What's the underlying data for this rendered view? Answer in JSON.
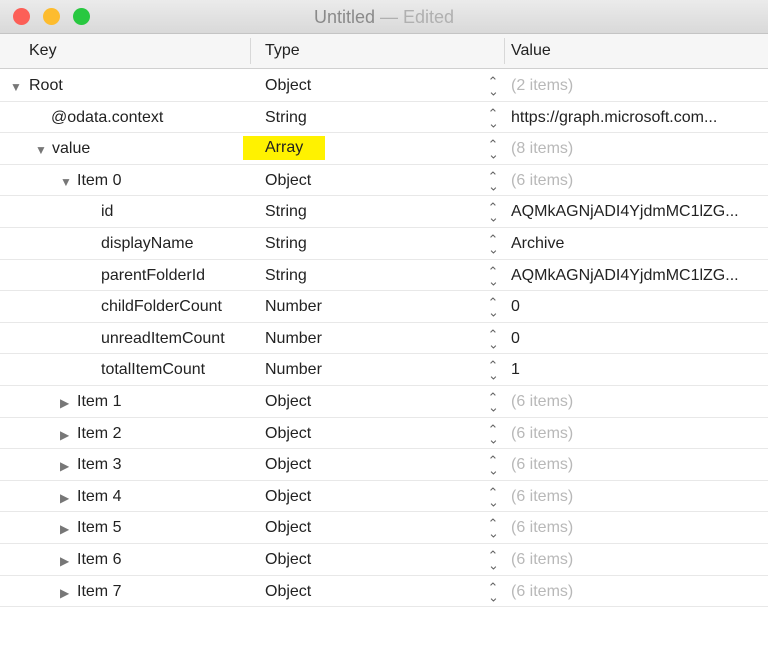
{
  "window": {
    "title": "Untitled",
    "edited": "— Edited"
  },
  "columns": {
    "key": "Key",
    "type": "Type",
    "value": "Value"
  },
  "rows": [
    {
      "key": "Root",
      "type": "Object",
      "value": "(2 items)",
      "level": 0,
      "expander": "expanded",
      "muted": true
    },
    {
      "key": "@odata.context",
      "type": "String",
      "value": "https://graph.microsoft.com...",
      "level": 1,
      "expander": "none"
    },
    {
      "key": "value",
      "type": "Array",
      "value": "(8 items)",
      "level": 1,
      "expander": "expanded",
      "muted": true,
      "highlight": true
    },
    {
      "key": "Item 0",
      "type": "Object",
      "value": "(6 items)",
      "level": 2,
      "expander": "expanded",
      "muted": true
    },
    {
      "key": "id",
      "type": "String",
      "value": "AQMkAGNjADI4YjdmMC1lZG...",
      "level": 3,
      "expander": "none"
    },
    {
      "key": "displayName",
      "type": "String",
      "value": "Archive",
      "level": 3,
      "expander": "none"
    },
    {
      "key": "parentFolderId",
      "type": "String",
      "value": "AQMkAGNjADI4YjdmMC1lZG...",
      "level": 3,
      "expander": "none"
    },
    {
      "key": "childFolderCount",
      "type": "Number",
      "value": "0",
      "level": 3,
      "expander": "none"
    },
    {
      "key": "unreadItemCount",
      "type": "Number",
      "value": "0",
      "level": 3,
      "expander": "none"
    },
    {
      "key": "totalItemCount",
      "type": "Number",
      "value": "1",
      "level": 3,
      "expander": "none"
    },
    {
      "key": "Item 1",
      "type": "Object",
      "value": "(6 items)",
      "level": 2,
      "expander": "collapsed",
      "muted": true
    },
    {
      "key": "Item 2",
      "type": "Object",
      "value": "(6 items)",
      "level": 2,
      "expander": "collapsed",
      "muted": true
    },
    {
      "key": "Item 3",
      "type": "Object",
      "value": "(6 items)",
      "level": 2,
      "expander": "collapsed",
      "muted": true
    },
    {
      "key": "Item 4",
      "type": "Object",
      "value": "(6 items)",
      "level": 2,
      "expander": "collapsed",
      "muted": true
    },
    {
      "key": "Item 5",
      "type": "Object",
      "value": "(6 items)",
      "level": 2,
      "expander": "collapsed",
      "muted": true
    },
    {
      "key": "Item 6",
      "type": "Object",
      "value": "(6 items)",
      "level": 2,
      "expander": "collapsed",
      "muted": true
    },
    {
      "key": "Item 7",
      "type": "Object",
      "value": "(6 items)",
      "level": 2,
      "expander": "collapsed",
      "muted": true
    }
  ],
  "colors": {
    "highlight": "#fff200",
    "close": "#fc5f57",
    "minimize": "#fdbc2e",
    "zoom": "#28c840"
  }
}
